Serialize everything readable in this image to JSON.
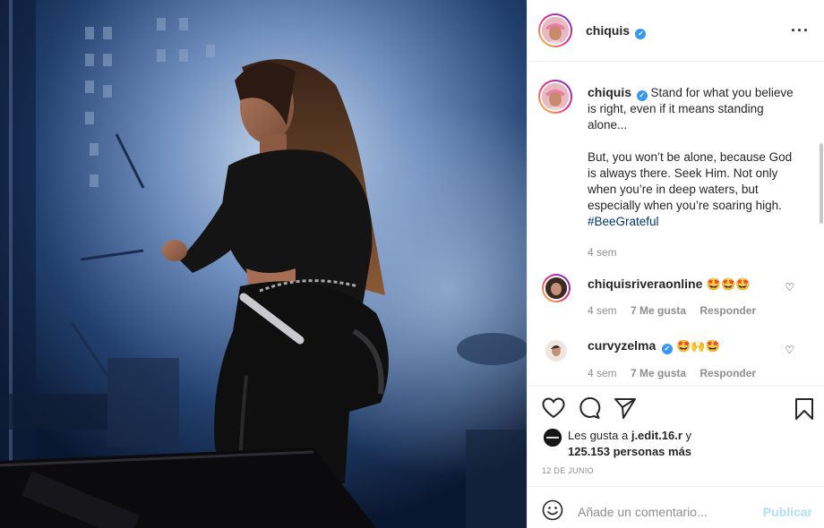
{
  "post": {
    "author": "chiquis",
    "verified_icon": "verified-badge-icon",
    "more_icon": "more-options-icon"
  },
  "caption": {
    "author": "chiquis",
    "line1": "Stand for what you believe is right, even if it means standing alone...",
    "line2": "But, you won’t be alone, because God is always there. Seek Him. Not only when you’re in deep waters, but especially when you’re soaring high.",
    "hashtag": "#BeeGrateful",
    "time": "4 sem"
  },
  "comments": [
    {
      "user": "chiquisriveraonline",
      "text": "🤩🤩🤩",
      "time": "4 sem",
      "likes": "7 Me gusta",
      "reply": "Responder"
    },
    {
      "user": "curvyzelma",
      "text": "🤩🙌🤩",
      "time": "4 sem",
      "likes": "7 Me gusta",
      "reply": "Responder"
    }
  ],
  "actions": {
    "like_icon": "heart-icon",
    "comment_icon": "comment-icon",
    "share_icon": "share-icon",
    "save_icon": "bookmark-icon"
  },
  "likes": {
    "line1_prefix": "Les gusta a ",
    "liker": "j.edit.16.r",
    "line1_suffix": " y",
    "line2": "125.153 personas más"
  },
  "date": "12 DE JUNIO",
  "add_comment": {
    "emoji_icon": "emoji-icon",
    "placeholder": "Añade un comentario...",
    "publish": "Publicar"
  },
  "colors": {
    "accent_link": "#00376b",
    "verified": "#3897f0",
    "publish_disabled": "#b2dffc",
    "muted": "#8e8e8e"
  }
}
